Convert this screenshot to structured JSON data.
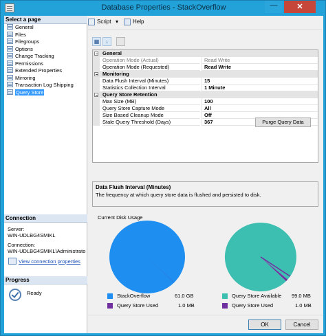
{
  "window": {
    "title": "Database Properties - StackOverflow",
    "minimize": "—",
    "close": "✕"
  },
  "sidebar": {
    "header": "Select a page",
    "items": [
      {
        "label": "General"
      },
      {
        "label": "Files"
      },
      {
        "label": "Filegroups"
      },
      {
        "label": "Options"
      },
      {
        "label": "Change Tracking"
      },
      {
        "label": "Permissions"
      },
      {
        "label": "Extended Properties"
      },
      {
        "label": "Mirroring"
      },
      {
        "label": "Transaction Log Shipping"
      },
      {
        "label": "Query Store",
        "selected": true
      }
    ]
  },
  "connection": {
    "header": "Connection",
    "server_label": "Server:",
    "server_value": "WIN-UDLBG4SMIKL",
    "connection_label": "Connection:",
    "connection_value": "WIN-UDLBG4SMIKL\\Administrato",
    "link": "View connection properties"
  },
  "progress": {
    "header": "Progress",
    "status": "Ready"
  },
  "toolbar": {
    "script": "Script",
    "script_arrow": "▾",
    "help": "Help"
  },
  "grid_toolbar": {
    "categorized": "▦",
    "alphabetical": "↓"
  },
  "propgrid": {
    "categories": [
      {
        "name": "General",
        "rows": [
          {
            "name": "Operation Mode (Actual)",
            "value": "Read Write",
            "readonly": true
          },
          {
            "name": "Operation Mode (Requested)",
            "value": "Read Write"
          }
        ]
      },
      {
        "name": "Monitoring",
        "rows": [
          {
            "name": "Data Flush Interval (Minutes)",
            "value": "15"
          },
          {
            "name": "Statistics Collection Interval",
            "value": "1 Minute"
          }
        ]
      },
      {
        "name": "Query Store Retention",
        "rows": [
          {
            "name": "Max Size (MB)",
            "value": "100"
          },
          {
            "name": "Query Store Capture Mode",
            "value": "All"
          },
          {
            "name": "Size Based Cleanup Mode",
            "value": "Off"
          },
          {
            "name": "Stale Query Threshold (Days)",
            "value": "367"
          }
        ]
      }
    ]
  },
  "description": {
    "title": "Data Flush Interval (Minutes)",
    "text": "The frequency at which query store data is flushed and persisted to disk."
  },
  "disk_usage": {
    "title": "Current Disk Usage",
    "left": {
      "items": [
        {
          "label": "StackOverflow",
          "value": "61.0 GB",
          "color": "#1e8ff0"
        },
        {
          "label": "Query Store Used",
          "value": "1.0 MB",
          "color": "#7030a0"
        }
      ]
    },
    "right": {
      "items": [
        {
          "label": "Query Store Available",
          "value": "99.0 MB",
          "color": "#3cbfb0"
        },
        {
          "label": "Query Store Used",
          "value": "1.0 MB",
          "color": "#7030a0"
        }
      ]
    },
    "purge_button": "Purge Query Data"
  },
  "chart_data": [
    {
      "type": "pie",
      "labels": [
        "StackOverflow",
        "Query Store Used"
      ],
      "values": [
        62464,
        1
      ],
      "units": "MB",
      "colors": [
        "#1e8ff0",
        "#7030a0"
      ]
    },
    {
      "type": "pie",
      "labels": [
        "Query Store Available",
        "Query Store Used"
      ],
      "values": [
        99,
        1
      ],
      "units": "MB",
      "colors": [
        "#3cbfb0",
        "#7030a0"
      ]
    }
  ],
  "footer": {
    "ok": "OK",
    "cancel": "Cancel"
  }
}
